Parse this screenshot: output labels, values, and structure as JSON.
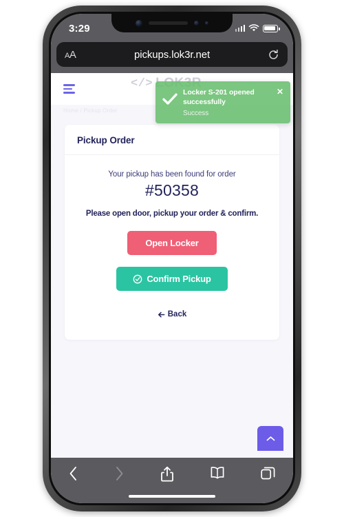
{
  "status_bar": {
    "time": "3:29",
    "signal_icon": "cellular-bars-icon",
    "wifi_icon": "wifi-icon",
    "battery_icon": "battery-icon"
  },
  "browser": {
    "url": "pickups.lok3r.net",
    "text_size_label": "AA",
    "reload_icon": "reload-icon",
    "toolbar": {
      "back_icon": "chevron-left-icon",
      "forward_icon": "chevron-right-icon",
      "share_icon": "share-icon",
      "bookmarks_icon": "book-icon",
      "tabs_icon": "tabs-icon"
    }
  },
  "page": {
    "logo_code": "</>",
    "logo_text": "LOK3R",
    "menu_icon": "hamburger-menu-icon",
    "breadcrumb": "Home / Pickup Order",
    "card": {
      "title": "Pickup Order",
      "found_text": "Your pickup has been found for order",
      "order_number": "#50358",
      "instruction": "Please open door, pickup your order & confirm.",
      "open_locker_label": "Open Locker",
      "confirm_label": "Confirm Pickup",
      "confirm_icon": "check-circle-icon",
      "back_label": "Back",
      "back_icon": "arrow-left-icon"
    },
    "scroll_top_icon": "chevron-up-icon"
  },
  "toast": {
    "title": "Locker S-201 opened successfully",
    "subtitle": "Success",
    "check_icon": "check-icon",
    "close_icon": "close-icon"
  },
  "colors": {
    "accent_purple": "#6c5ce7",
    "danger": "#ef5f75",
    "success": "#2bc4a2",
    "toast_green": "#69be6e",
    "text_navy": "#23235b",
    "page_bg": "#f6f6fb"
  }
}
